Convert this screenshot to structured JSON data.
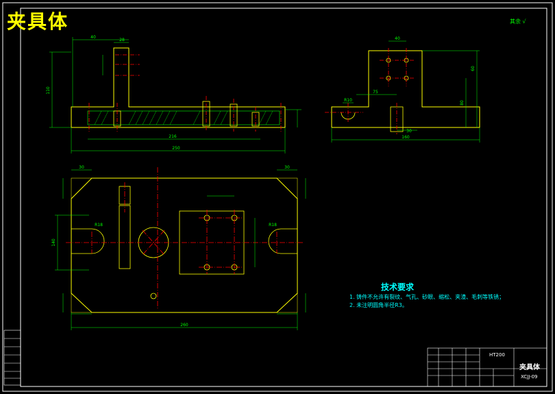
{
  "drawing": {
    "title": "夹具体",
    "corner_mark": "其余",
    "tech_req": {
      "heading": "技术要求",
      "line1": "1. 铸件不允许有裂纹、气孔、砂眼、缩松、夹渣、毛刺等铁锈；",
      "line2": "2. 未注明圆角半径R3。"
    },
    "dims": {
      "front_overall_width": "250",
      "front_inner_width": "216",
      "front_height": "110",
      "front_top_width": "40",
      "front_top_small": "28",
      "side_r10": "R10",
      "side_width": "160",
      "side_height_a": "60",
      "side_height_b": "80",
      "side_dim_75": "75",
      "side_dim_40": "40",
      "side_dim_30": "30",
      "plan_corner": "30",
      "plan_corner_b": "30",
      "plan_r18": "R18",
      "plan_r18b": "R18",
      "plan_overall": "260",
      "plan_height": "140"
    },
    "title_block": {
      "part_name": "夹具体",
      "drawing_no": "XCJJ-09",
      "material": "HT200"
    }
  },
  "colors": {
    "line": "#ffffff",
    "outline": "#ffff00",
    "dim": "#00ff00",
    "center": "#ff0000",
    "text": "#00ffff",
    "title": "#ffff00",
    "req": "#00ffff"
  }
}
